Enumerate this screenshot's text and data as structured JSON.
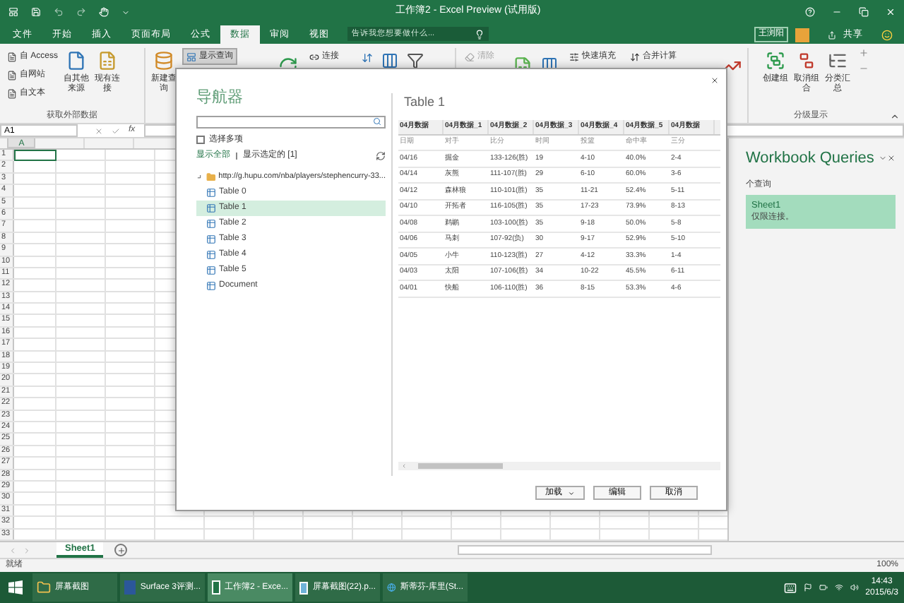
{
  "title_bar": {
    "title": "工作簿2 - Excel Preview (试用版)"
  },
  "ribbon_tabs": [
    {
      "label": "文件",
      "selected": false
    },
    {
      "label": "开始",
      "selected": false
    },
    {
      "label": "插入",
      "selected": false
    },
    {
      "label": "页面布局",
      "selected": false
    },
    {
      "label": "公式",
      "selected": false
    },
    {
      "label": "数据",
      "selected": true
    },
    {
      "label": "审阅",
      "selected": false
    },
    {
      "label": "视图",
      "selected": false
    }
  ],
  "tell_me": {
    "placeholder": "告诉我您想要做什么..."
  },
  "account": {
    "user": "王浏阳",
    "share": "共享"
  },
  "ribbon": {
    "get_data": {
      "label": "获取外部数据",
      "small": [
        "自 Access",
        "自网站",
        "自文本"
      ],
      "large": [
        "自其他来源",
        "现有连接"
      ]
    },
    "query": {
      "new_query": "新建查询",
      "show_queries": {
        "label": "显示查询",
        "selected": true
      }
    },
    "connections": [
      {
        "label": "连接",
        "disabled": false
      },
      {
        "label": "清除",
        "disabled": true
      }
    ],
    "tools": [
      "快速填充",
      "合并计算"
    ],
    "outline": {
      "label": "分级显示",
      "buttons": [
        "创建组",
        "取消组合",
        "分类汇总"
      ]
    }
  },
  "formula_bar": {
    "name_box": "A1",
    "function_label": "fx"
  },
  "sheet": {
    "column_headers": [
      "A"
    ],
    "row_headers": [
      "1",
      "2",
      "3",
      "4",
      "5",
      "6",
      "7",
      "8",
      "9",
      "10",
      "11",
      "12",
      "13",
      "14",
      "15",
      "16",
      "17",
      "18",
      "19",
      "20",
      "21",
      "22",
      "23",
      "24",
      "25",
      "26",
      "27",
      "28",
      "29",
      "30",
      "31",
      "32",
      "33"
    ]
  },
  "navigator": {
    "title": "导航器",
    "select_multiple": {
      "label": "选择多项",
      "checked": false
    },
    "show_all": "显示全部",
    "show_selected": "显示选定的 [1]",
    "tree": {
      "label": "http://g.hupu.com/nba/players/stephencurry-33...",
      "expanded": true,
      "children": [
        {
          "label": "Table 0",
          "selected": false
        },
        {
          "label": "Table 1",
          "selected": true
        },
        {
          "label": "Table 2",
          "selected": false
        },
        {
          "label": "Table 3",
          "selected": false
        },
        {
          "label": "Table 4",
          "selected": false
        },
        {
          "label": "Table 5",
          "selected": false
        },
        {
          "label": "Document",
          "selected": false
        }
      ]
    },
    "preview": {
      "title": "Table 1",
      "columns": [
        "04月数据",
        "04月数据_1",
        "04月数据_2",
        "04月数据_3",
        "04月数据_4",
        "04月数据_5",
        "04月数据"
      ],
      "rows": [
        [
          "日期",
          "对手",
          "比分",
          "时间",
          "投篮",
          "命中率",
          "三分"
        ],
        [
          "04/16",
          "掘金",
          "133-126(胜)",
          "19",
          "4-10",
          "40.0%",
          "2-4"
        ],
        [
          "04/14",
          "灰熊",
          "111-107(胜)",
          "29",
          "6-10",
          "60.0%",
          "3-6"
        ],
        [
          "04/12",
          "森林狼",
          "110-101(胜)",
          "35",
          "11-21",
          "52.4%",
          "5-11"
        ],
        [
          "04/10",
          "开拓者",
          "116-105(胜)",
          "35",
          "17-23",
          "73.9%",
          "8-13"
        ],
        [
          "04/08",
          "鹈鹕",
          "103-100(胜)",
          "35",
          "9-18",
          "50.0%",
          "5-8"
        ],
        [
          "04/06",
          "马刺",
          "107-92(负)",
          "30",
          "9-17",
          "52.9%",
          "5-10"
        ],
        [
          "04/05",
          "小牛",
          "110-123(胜)",
          "27",
          "4-12",
          "33.3%",
          "1-4"
        ],
        [
          "04/03",
          "太阳",
          "107-106(胜)",
          "34",
          "10-22",
          "45.5%",
          "6-11"
        ],
        [
          "04/01",
          "快船",
          "106-110(胜)",
          "36",
          "8-15",
          "53.3%",
          "4-6"
        ]
      ]
    },
    "buttons": {
      "load": "加载",
      "edit": "编辑",
      "cancel": "取消"
    }
  },
  "queries_pane": {
    "title": "Workbook Queries",
    "count": "个查询",
    "queries": [
      {
        "name": "Sheet1",
        "status": "仅限连接。",
        "selected": true
      }
    ]
  },
  "sheet_tabs": [
    {
      "label": "Sheet1",
      "selected": true
    }
  ],
  "status_bar": {
    "status": "就绪",
    "zoom": "100%"
  },
  "taskbar": {
    "items": [
      {
        "kind": "folder",
        "label": "屏幕截图",
        "selected": false
      },
      {
        "kind": "word",
        "label": "Surface 3评测...",
        "selected": false
      },
      {
        "kind": "excel",
        "label": "工作簿2 - Exce...",
        "selected": true
      },
      {
        "kind": "image",
        "label": "屏幕截图(22).p...",
        "selected": false
      },
      {
        "kind": "browser",
        "label": "斯蒂芬-库里(St...",
        "selected": false
      }
    ],
    "time": "14:43",
    "date": "2015/6/3"
  }
}
